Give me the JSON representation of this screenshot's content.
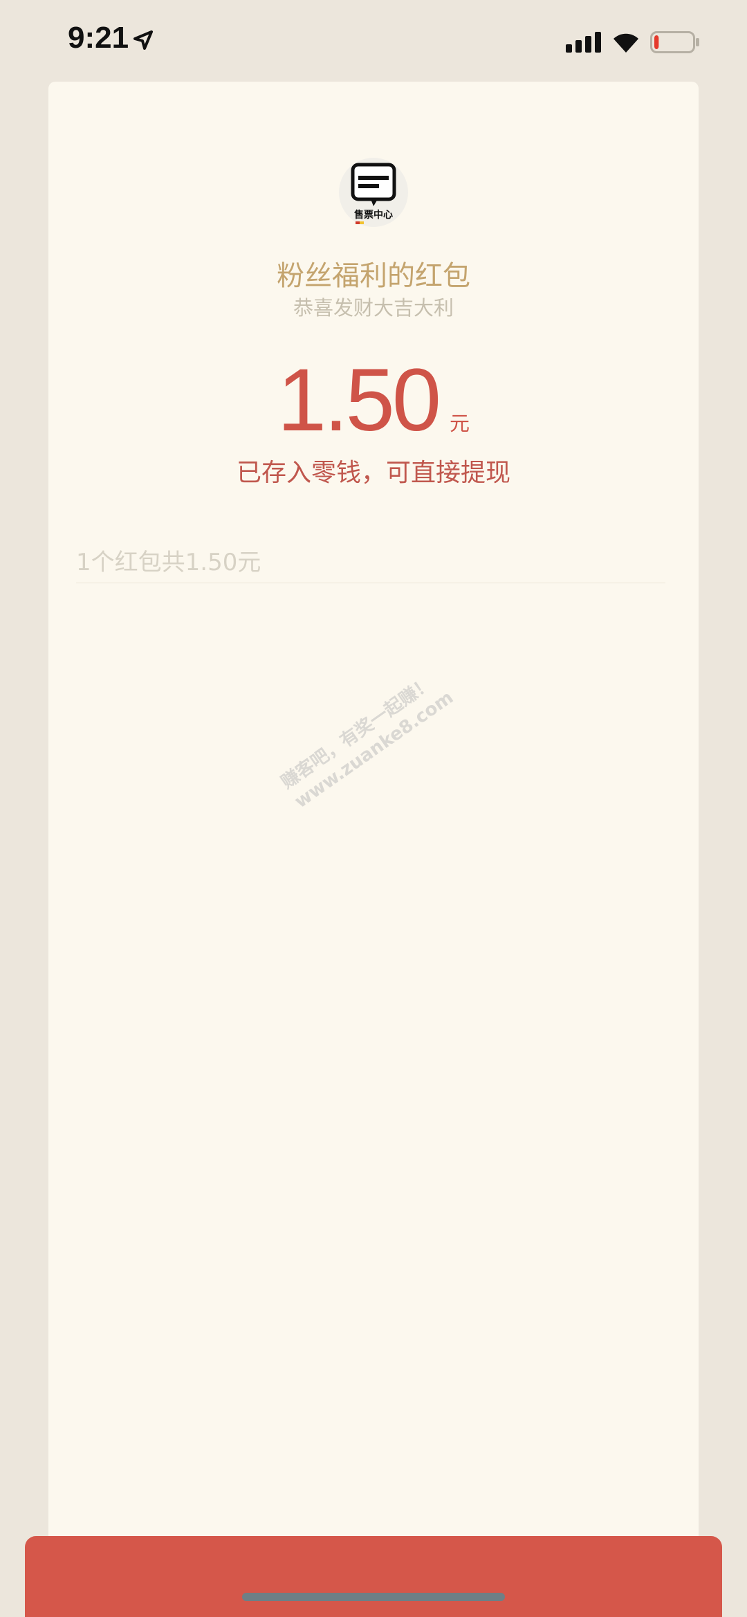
{
  "status_bar": {
    "time": "9:21",
    "battery_level": 0.12,
    "battery_color": "#e53a2c"
  },
  "avatar": {
    "label": "售票中心",
    "icon": "chat-bubble-icon"
  },
  "packet": {
    "sender": "粉丝福利的红包",
    "greeting": "恭喜发财大吉大利",
    "amount": "1.50",
    "unit": "元",
    "note": "已存入零钱，可直接提现",
    "summary": "1个红包共1.50元"
  },
  "watermark": {
    "line1": "赚客吧，有奖一起赚！",
    "line2": "www.zuanke8.com"
  },
  "colors": {
    "accent_red": "#cf5448",
    "gold": "#c4a46e",
    "card_bg": "#fcf8ee",
    "page_bg": "#ece6dc"
  }
}
